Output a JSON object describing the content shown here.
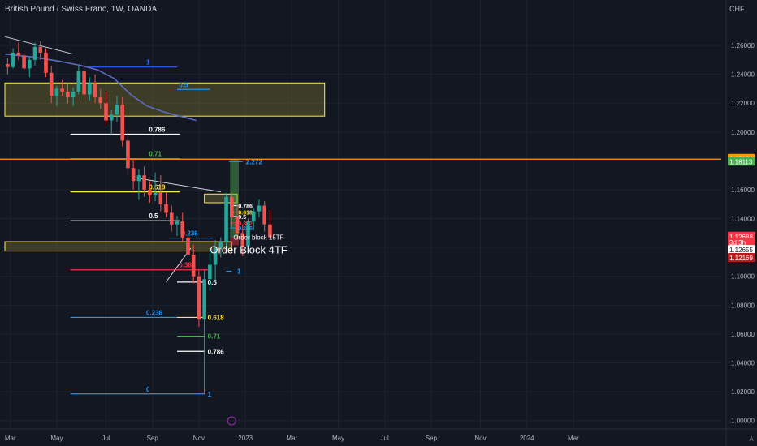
{
  "header": {
    "title": "British Pound / Swiss Franc, 1W, OANDA",
    "currency": "CHF"
  },
  "chart_data": {
    "type": "candlestick",
    "y_axis": {
      "min": 1.0,
      "max": 1.27,
      "ticks": [
        "1.26000",
        "1.24000",
        "1.22000",
        "1.20000",
        "1.18000",
        "1.16000",
        "1.14000",
        "1.12000",
        "1.10000",
        "1.08000",
        "1.06000",
        "1.04000",
        "1.02000",
        "1.00000"
      ]
    },
    "x_axis": {
      "ticks": [
        {
          "label": "Mar",
          "t": 1
        },
        {
          "label": "May",
          "t": 9.5
        },
        {
          "label": "Jul",
          "t": 18.5
        },
        {
          "label": "Sep",
          "t": 27
        },
        {
          "label": "Nov",
          "t": 35.5
        },
        {
          "label": "2023",
          "t": 44
        },
        {
          "label": "Mar",
          "t": 52.5
        },
        {
          "label": "May",
          "t": 61
        },
        {
          "label": "Jul",
          "t": 69.5
        },
        {
          "label": "Sep",
          "t": 78
        },
        {
          "label": "Nov",
          "t": 87
        },
        {
          "label": "2024",
          "t": 95.5
        },
        {
          "label": "Mar",
          "t": 104
        }
      ]
    },
    "candles": [
      [
        1.247,
        1.251,
        1.24,
        1.245
      ],
      [
        1.245,
        1.258,
        1.244,
        1.255
      ],
      [
        1.255,
        1.262,
        1.25,
        1.253
      ],
      [
        1.253,
        1.259,
        1.242,
        1.244
      ],
      [
        1.244,
        1.252,
        1.238,
        1.25
      ],
      [
        1.25,
        1.262,
        1.246,
        1.259
      ],
      [
        1.259,
        1.263,
        1.25,
        1.255
      ],
      [
        1.255,
        1.258,
        1.238,
        1.241
      ],
      [
        1.241,
        1.246,
        1.22,
        1.225
      ],
      [
        1.225,
        1.232,
        1.218,
        1.23
      ],
      [
        1.23,
        1.236,
        1.225,
        1.228
      ],
      [
        1.228,
        1.234,
        1.22,
        1.224
      ],
      [
        1.224,
        1.231,
        1.218,
        1.228
      ],
      [
        1.228,
        1.246,
        1.226,
        1.242
      ],
      [
        1.242,
        1.248,
        1.222,
        1.226
      ],
      [
        1.226,
        1.238,
        1.222,
        1.234
      ],
      [
        1.234,
        1.24,
        1.22,
        1.224
      ],
      [
        1.224,
        1.23,
        1.216,
        1.22
      ],
      [
        1.22,
        1.228,
        1.205,
        1.208
      ],
      [
        1.208,
        1.215,
        1.198,
        1.212
      ],
      [
        1.212,
        1.225,
        1.207,
        1.219
      ],
      [
        1.219,
        1.224,
        1.19,
        1.194
      ],
      [
        1.194,
        1.201,
        1.17,
        1.175
      ],
      [
        1.175,
        1.182,
        1.16,
        1.166
      ],
      [
        1.166,
        1.174,
        1.153,
        1.17
      ],
      [
        1.17,
        1.176,
        1.155,
        1.16
      ],
      [
        1.16,
        1.166,
        1.151,
        1.156
      ],
      [
        1.156,
        1.172,
        1.152,
        1.158
      ],
      [
        1.158,
        1.17,
        1.145,
        1.15
      ],
      [
        1.15,
        1.158,
        1.141,
        1.144
      ],
      [
        1.144,
        1.149,
        1.131,
        1.136
      ],
      [
        1.136,
        1.142,
        1.128,
        1.138
      ],
      [
        1.138,
        1.144,
        1.124,
        1.127
      ],
      [
        1.127,
        1.133,
        1.112,
        1.115
      ],
      [
        1.115,
        1.122,
        1.095,
        1.1
      ],
      [
        1.1,
        1.104,
        1.065,
        1.07
      ],
      [
        1.07,
        1.104,
        1.018,
        1.098
      ],
      [
        1.098,
        1.118,
        1.09,
        1.108
      ],
      [
        1.108,
        1.125,
        1.096,
        1.12
      ],
      [
        1.12,
        1.127,
        1.113,
        1.124
      ],
      [
        1.124,
        1.158,
        1.118,
        1.155
      ],
      [
        1.155,
        1.158,
        1.134,
        1.141
      ],
      [
        1.141,
        1.15,
        1.125,
        1.13
      ],
      [
        1.13,
        1.136,
        1.114,
        1.121
      ],
      [
        1.121,
        1.14,
        1.116,
        1.138
      ],
      [
        1.138,
        1.147,
        1.132,
        1.145
      ],
      [
        1.145,
        1.153,
        1.141,
        1.149
      ],
      [
        1.149,
        1.152,
        1.131,
        1.136
      ],
      [
        1.136,
        1.146,
        1.133,
        1.127
      ]
    ],
    "moving_average": [
      [
        0,
        1.254
      ],
      [
        5,
        1.252
      ],
      [
        10,
        1.249
      ],
      [
        14,
        1.246
      ],
      [
        17,
        1.243
      ],
      [
        20,
        1.237
      ],
      [
        23,
        1.226
      ],
      [
        26,
        1.218
      ],
      [
        29,
        1.214
      ],
      [
        32,
        1.211
      ],
      [
        35,
        1.208
      ]
    ],
    "zones": [
      {
        "name": "upper-zone",
        "t0": 0,
        "t1": 58.5,
        "y0": 1.211,
        "y1": 1.234
      },
      {
        "name": "order-block-zone",
        "t0": 0,
        "t1": 41.5,
        "y0": 1.1175,
        "y1": 1.124
      },
      {
        "name": "small-zone",
        "t0": 36.5,
        "t1": 42.5,
        "y0": 1.151,
        "y1": 1.157
      }
    ],
    "fib_levels": [
      {
        "label": "1",
        "value": 1.245,
        "t0": 15,
        "t1": 31.5,
        "color": "#2962ff"
      },
      {
        "label": "0.5",
        "value": 1.2295,
        "t0": 31.5,
        "t1": 37.5,
        "color": "#2196f3"
      },
      {
        "label": "0.786",
        "value": 1.1985,
        "t0": 12,
        "t1": 32,
        "color": "#ffffff"
      },
      {
        "label": "0.71",
        "value": 1.1815,
        "t0": 12,
        "t1": 32,
        "color": "#4caf50"
      },
      {
        "label": "0.618",
        "value": 1.1585,
        "t0": 12,
        "t1": 32,
        "color": "#ffeb3b"
      },
      {
        "label": "0.5",
        "value": 1.1385,
        "t0": 12,
        "t1": 32,
        "color": "#ffffff"
      },
      {
        "label": "0.236",
        "value": 1.1265,
        "t0": 30,
        "t1": 38,
        "color": "#2196f3"
      },
      {
        "label": "0.382",
        "value": 1.1045,
        "t0": 12,
        "t1": 37.5,
        "color": "#f23645"
      },
      {
        "label": "0.236",
        "value": 1.0715,
        "t0": 12,
        "t1": 31.5,
        "color": "#2196f3"
      },
      {
        "label": "0",
        "value": 1.0185,
        "t0": 12,
        "t1": 31.5,
        "color": "#2196f3"
      }
    ],
    "fib_levels_2": [
      {
        "label": "2.272",
        "value": 1.1795,
        "t0": 41,
        "t1": 43.5,
        "color": "#2196f3"
      },
      {
        "label": "0.5",
        "value": 1.096,
        "t0": 31.5,
        "t1": 36.5,
        "color": "#ffffff"
      },
      {
        "label": "0.618",
        "value": 1.0715,
        "t0": 31.5,
        "t1": 36.5,
        "color": "#ffeb3b"
      },
      {
        "label": "0.71",
        "value": 1.0585,
        "t0": 31.5,
        "t1": 36.5,
        "color": "#4caf50"
      },
      {
        "label": "0.786",
        "value": 1.048,
        "t0": 31.5,
        "t1": 36.5,
        "color": "#ffffff"
      },
      {
        "label": "1",
        "value": 1.0185,
        "t0": 31.5,
        "t1": 36.5,
        "color": "#2196f3"
      },
      {
        "label": "-1",
        "value": 1.1035,
        "t0": 40.5,
        "t1": 41.5,
        "color": "#2196f3"
      }
    ],
    "small_fib": [
      {
        "label": "0.786",
        "value": 1.149,
        "color": "#ffffff"
      },
      {
        "label": "0.618",
        "value": 1.1445,
        "color": "#ffeb3b"
      },
      {
        "label": "0.5",
        "value": 1.1415,
        "color": "#ffffff"
      },
      {
        "label": "0.382",
        "value": 1.137,
        "color": "#f23645"
      },
      {
        "label": "0.236",
        "value": 1.1335,
        "color": "#2196f3"
      }
    ],
    "resistance_lines": [
      {
        "value": 1.1812,
        "color": "#ff9800"
      }
    ],
    "trend_lines": [
      [
        0,
        1.266,
        12.5,
        1.254
      ],
      [
        23.5,
        1.1685,
        39.5,
        1.1585
      ],
      [
        29.5,
        1.096,
        34,
        1.1195
      ]
    ],
    "position_box": {
      "t0": 41.2,
      "t1": 42.8,
      "entry": 1.127,
      "target": 1.181,
      "stop": 1.1215
    },
    "price_tags": [
      {
        "label": "1.18124",
        "value": 1.1815,
        "bg": "#ff9800"
      },
      {
        "label": "1.18113",
        "value": 1.1795,
        "bg": "#4caf50"
      },
      {
        "label": "1.12688",
        "value": 1.1275,
        "bg": "#f23645"
      },
      {
        "label": "3d 3h",
        "value": 1.1235,
        "bg": "#f23645"
      },
      {
        "label": "1.12655",
        "value": 1.1183,
        "bg": "#ffffff"
      },
      {
        "label": "1.12169",
        "value": 1.1128,
        "bg": "#b71c1c"
      }
    ],
    "annotations": [
      {
        "text": "Order Block 4TF",
        "t": 37.5,
        "value": 1.116,
        "size": 13
      },
      {
        "text": "Order block 15TF",
        "t": 41.8,
        "value": 1.1255,
        "size": 8
      }
    ]
  }
}
